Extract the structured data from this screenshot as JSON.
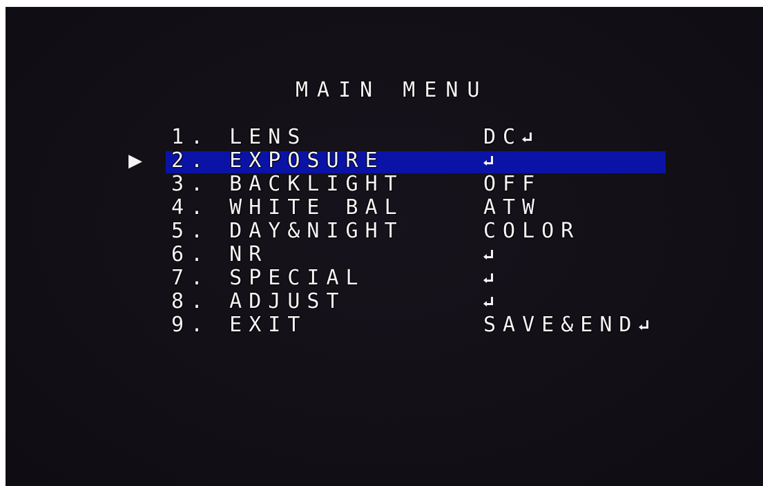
{
  "title": "MAIN MENU",
  "cursor_glyph": "▶",
  "colors": {
    "background": "#120f17",
    "text": "#f4f4f4",
    "highlight": "#0a13a6"
  },
  "selected_index": 1,
  "items": [
    {
      "label": "1. LENS",
      "value": "DC",
      "enter": true
    },
    {
      "label": "2. EXPOSURE",
      "value": "",
      "enter": true
    },
    {
      "label": "3. BACKLIGHT",
      "value": "OFF",
      "enter": false
    },
    {
      "label": "4. WHITE BAL",
      "value": "ATW",
      "enter": false
    },
    {
      "label": "5. DAY&NIGHT",
      "value": "COLOR",
      "enter": false
    },
    {
      "label": "6. NR",
      "value": "",
      "enter": true
    },
    {
      "label": "7. SPECIAL",
      "value": "",
      "enter": true
    },
    {
      "label": "8. ADJUST",
      "value": "",
      "enter": true
    },
    {
      "label": "9. EXIT",
      "value": "SAVE&END",
      "enter": true
    }
  ],
  "icons": {
    "enter": "enter-return-icon",
    "cursor": "triangle-right-icon"
  }
}
